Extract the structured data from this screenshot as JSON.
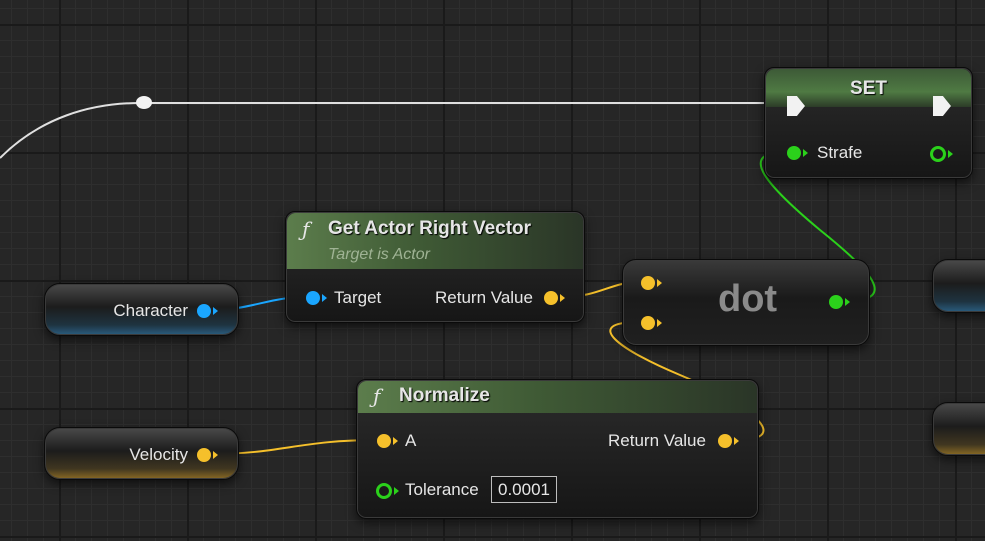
{
  "graph": {
    "colors": {
      "exec_wire": "#e0e0e0",
      "object_wire": "#1aa6ff",
      "vector_wire": "#f5c02b",
      "float_wire": "#2bd11b"
    },
    "nodes": {
      "set": {
        "title": "SET",
        "pin_label": "Strafe"
      },
      "get_actor_right_vector": {
        "icon": "function-icon",
        "title": "Get Actor Right Vector",
        "subtitle": "Target is Actor",
        "input_label": "Target",
        "output_label": "Return Value"
      },
      "dot": {
        "title": "dot"
      },
      "normalize": {
        "icon": "function-icon",
        "title": "Normalize",
        "input_a_label": "A",
        "tolerance_label": "Tolerance",
        "tolerance_value": "0.0001",
        "output_label": "Return Value"
      },
      "character_var": {
        "label": "Character"
      },
      "velocity_var": {
        "label": "Velocity"
      }
    }
  }
}
